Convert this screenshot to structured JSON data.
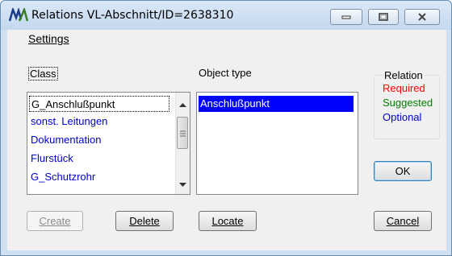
{
  "window": {
    "title": "Relations VL-Abschnitt/ID=2638310",
    "icon": "app-logo-icon"
  },
  "menu": {
    "settings_label": "Settings"
  },
  "class_list": {
    "label": "Class",
    "items": [
      "G_Anschlußpunkt",
      "sonst. Leitungen",
      "Dokumentation",
      "Flurstück",
      "G_Schutzrohr"
    ]
  },
  "object_type_list": {
    "label": "Object type",
    "items": [
      "Anschlußpunkt"
    ]
  },
  "relation": {
    "title": "Relation",
    "required": "Required",
    "suggested": "Suggested",
    "optional": "Optional",
    "colors": {
      "required": "#ff0000",
      "suggested": "#008000",
      "optional": "#0000cc"
    }
  },
  "buttons": {
    "create": "Create",
    "delete": "Delete",
    "locate": "Locate",
    "cancel": "Cancel",
    "ok": "OK"
  }
}
